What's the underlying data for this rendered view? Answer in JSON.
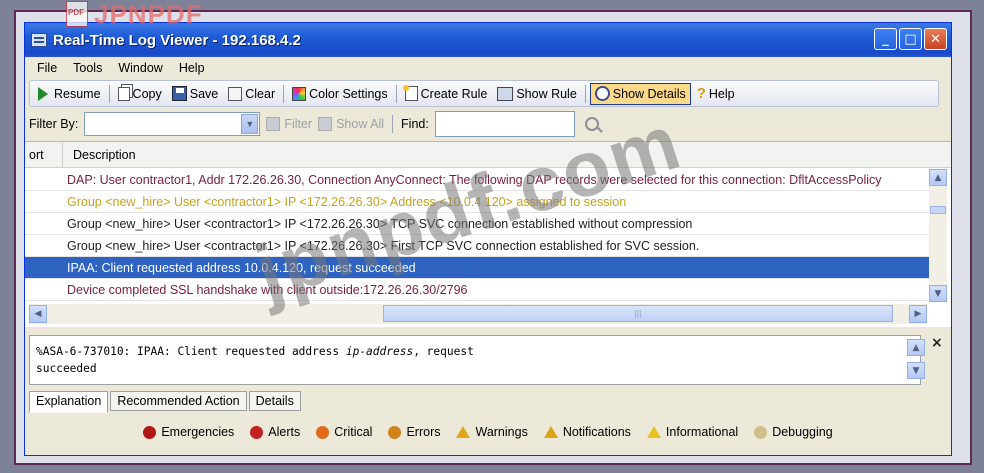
{
  "watermark": {
    "logo_text": "JPNPDF",
    "pdf_label": "PDF",
    "overlay": "jpnpdf.com"
  },
  "window": {
    "title": "Real-Time Log Viewer - 192.168.4.2"
  },
  "window_buttons": {
    "minimize": "_",
    "maximize": "□",
    "close": "✕"
  },
  "menu": [
    "File",
    "Tools",
    "Window",
    "Help"
  ],
  "toolbar": {
    "resume": "Resume",
    "copy": "Copy",
    "save": "Save",
    "clear": "Clear",
    "color_settings": "Color Settings",
    "create_rule": "Create Rule",
    "show_rule": "Show Rule",
    "show_details": "Show Details",
    "help": "Help"
  },
  "filter": {
    "label": "Filter By:",
    "filter_btn": "Filter",
    "show_all_btn": "Show All",
    "find_label": "Find:"
  },
  "table": {
    "col_port": "ort",
    "col_desc": "Description",
    "rows": [
      {
        "text": "DAP: User contractor1, Addr 172.26.26.30, Connection AnyConnect: The following DAP records were selected for this connection: DfltAccessPolicy",
        "color": "#7a1e3a"
      },
      {
        "text": "Group <new_hire> User <contractor1> IP <172.26.26.30> Address <10.0.4.120> assigned to session",
        "color": "#c9a11a"
      },
      {
        "text": "Group <new_hire> User <contractor1> IP <172.26.26.30> TCP SVC connection established without compression",
        "color": "#222222"
      },
      {
        "text": "Group <new_hire> User <contractor1> IP <172.26.26.30> First TCP SVC connection established for SVC session.",
        "color": "#222222"
      },
      {
        "text": "IPAA: Client requested address 10.0.4.120, request succeeded",
        "color": "#ffffff"
      },
      {
        "text": "Device completed SSL handshake with client outside:172.26.26.30/2796",
        "color": "#7a1e3a"
      }
    ]
  },
  "details": {
    "line1_prefix": "%ASA-6-737010: IPAA: Client requested address ",
    "line1_var": "ip-address",
    "line1_suffix": ", request",
    "line2": "succeeded",
    "close": "×"
  },
  "tabs": [
    "Explanation",
    "Recommended Action",
    "Details"
  ],
  "legend": [
    {
      "label": "Emergencies",
      "color": "#b01818"
    },
    {
      "label": "Alerts",
      "color": "#c42222"
    },
    {
      "label": "Critical",
      "color": "#e06a1a"
    },
    {
      "label": "Errors",
      "color": "#d2821a"
    },
    {
      "label": "Warnings",
      "color": "#e0a818"
    },
    {
      "label": "Notifications",
      "color": "#d9a514"
    },
    {
      "label": "Informational",
      "color": "#e7c322"
    },
    {
      "label": "Debugging",
      "color": "#cfc08a"
    }
  ]
}
